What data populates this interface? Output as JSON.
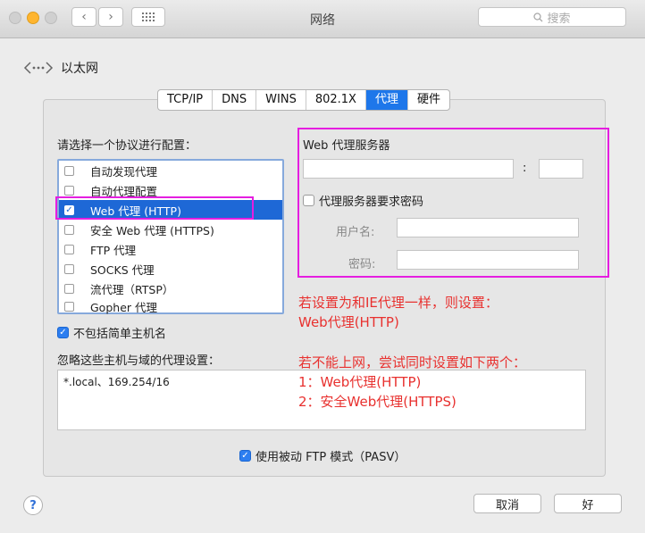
{
  "window": {
    "title": "网络",
    "search_placeholder": "搜索"
  },
  "back": {
    "label": "以太网"
  },
  "tabs": [
    {
      "label": "TCP/IP",
      "active": false
    },
    {
      "label": "DNS",
      "active": false
    },
    {
      "label": "WINS",
      "active": false
    },
    {
      "label": "802.1X",
      "active": false
    },
    {
      "label": "代理",
      "active": true
    },
    {
      "label": "硬件",
      "active": false
    }
  ],
  "protocols": {
    "heading": "请选择一个协议进行配置：",
    "items": [
      {
        "label": "自动发现代理",
        "checked": false,
        "selected": false
      },
      {
        "label": "自动代理配置",
        "checked": false,
        "selected": false
      },
      {
        "label": "Web 代理 (HTTP)",
        "checked": true,
        "selected": true
      },
      {
        "label": "安全 Web 代理 (HTTPS)",
        "checked": false,
        "selected": false
      },
      {
        "label": "FTP 代理",
        "checked": false,
        "selected": false
      },
      {
        "label": "SOCKS 代理",
        "checked": false,
        "selected": false
      },
      {
        "label": "流代理（RTSP）",
        "checked": false,
        "selected": false
      },
      {
        "label": "Gopher 代理",
        "checked": false,
        "selected": false
      }
    ]
  },
  "exclude_simple": {
    "label": "不包括简单主机名",
    "checked": true
  },
  "bypass": {
    "heading": "忽略这些主机与域的代理设置：",
    "value": "*.local、169.254/16"
  },
  "server": {
    "heading": "Web 代理服务器",
    "colon": ":",
    "require_password": {
      "label": "代理服务器要求密码",
      "checked": false
    },
    "username_label": "用户名:",
    "password_label": "密码:"
  },
  "pasv": {
    "label": "使用被动 FTP 模式（PASV）",
    "checked": true
  },
  "notes": {
    "n1_line1": "若设置为和IE代理一样，则设置：",
    "n1_line2": "Web代理(HTTP)",
    "n2_line1": "若不能上网，尝试同时设置如下两个：",
    "n2_line2": "1：Web代理(HTTP)",
    "n2_line3": "2：安全Web代理(HTTPS)"
  },
  "buttons": {
    "help": "?",
    "cancel": "取消",
    "ok": "好"
  },
  "colors": {
    "accent": "#1e77ea",
    "highlight": "#e51ee0",
    "note": "#e8312f"
  }
}
